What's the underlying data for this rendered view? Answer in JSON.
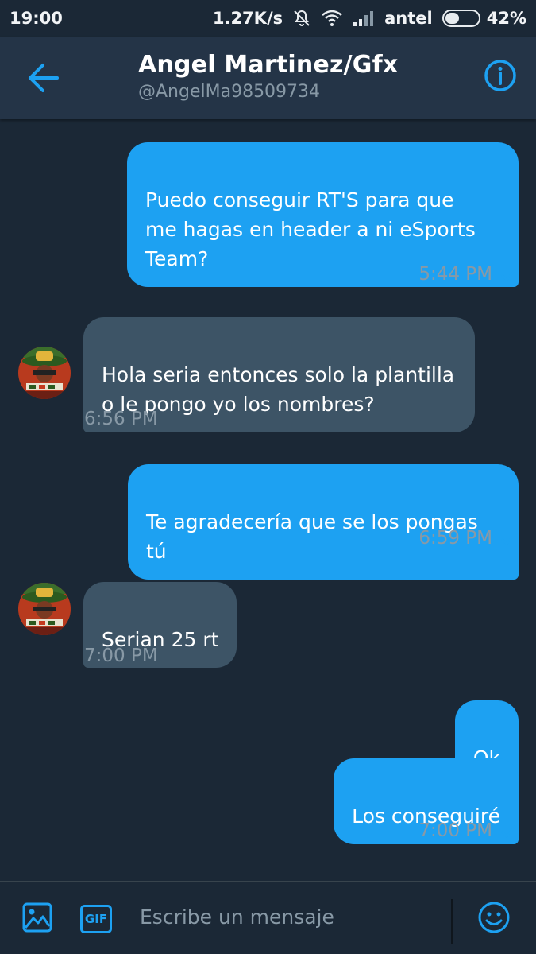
{
  "status_bar": {
    "time": "19:00",
    "network_speed": "1.27K/s",
    "carrier": "antel",
    "battery": "42%",
    "battery_level": 0.42
  },
  "header": {
    "name": "Angel Martinez/Gfx",
    "handle": "@AngelMa98509734",
    "back_icon": "arrow-left-icon",
    "info_icon": "info-circle-icon"
  },
  "messages": [
    {
      "direction": "sent",
      "text": "Puedo conseguir RT'S para que\nme hagas en header a ni eSports\nTeam?",
      "time": "5:44 PM"
    },
    {
      "direction": "received",
      "text": "Hola seria entonces solo la plantilla\no le pongo yo los nombres?",
      "time": "6:56 PM"
    },
    {
      "direction": "sent",
      "text": "Te agradecería que se los pongas tú",
      "time": "6:59 PM"
    },
    {
      "direction": "received",
      "text": "Serian 25 rt",
      "time": "7:00 PM"
    },
    {
      "direction": "sent",
      "text": "Ok",
      "time": ""
    },
    {
      "direction": "sent",
      "text": "Los conseguiré",
      "time": "7:00 PM"
    }
  ],
  "composer": {
    "placeholder": "Escribe un mensaje",
    "gif_label": "GIF",
    "image_icon": "image-icon",
    "emoji_icon": "smiley-icon"
  },
  "colors": {
    "background": "#1b2836",
    "header": "#243447",
    "sent_bubble": "#1da1f2",
    "received_bubble": "#3d5466",
    "accent": "#1da1f2",
    "muted_text": "#8899a6"
  }
}
